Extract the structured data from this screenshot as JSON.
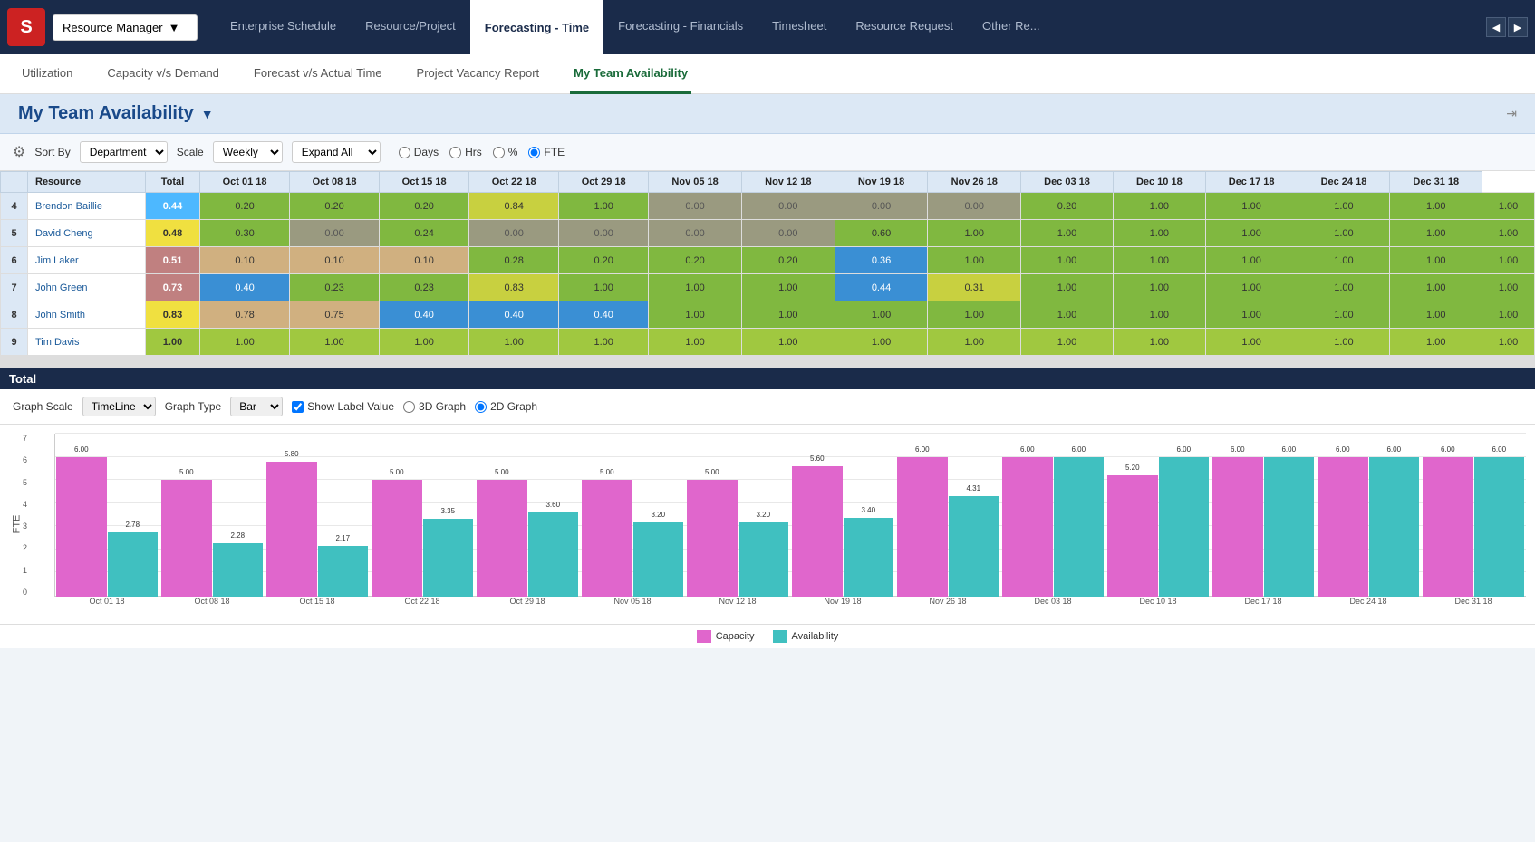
{
  "app": {
    "logo": "S",
    "resource_manager_label": "Resource Manager",
    "nav_arrow_left": "◀",
    "nav_arrow_right": "▶"
  },
  "top_nav": {
    "items": [
      {
        "label": "Enterprise Schedule",
        "active": false
      },
      {
        "label": "Resource/Project",
        "active": false
      },
      {
        "label": "Forecasting - Time",
        "active": true
      },
      {
        "label": "Forecasting - Financials",
        "active": false
      },
      {
        "label": "Timesheet",
        "active": false
      },
      {
        "label": "Resource Request",
        "active": false
      },
      {
        "label": "Other Re...",
        "active": false
      }
    ]
  },
  "sub_nav": {
    "items": [
      {
        "label": "Utilization",
        "active": false
      },
      {
        "label": "Capacity v/s Demand",
        "active": false
      },
      {
        "label": "Forecast v/s Actual Time",
        "active": false
      },
      {
        "label": "Project Vacancy Report",
        "active": false
      },
      {
        "label": "My Team Availability",
        "active": true
      }
    ]
  },
  "page_title": "My Team Availability",
  "toolbar": {
    "sort_by_label": "Sort By",
    "sort_by_value": "Department",
    "scale_label": "Scale",
    "scale_value": "Weekly",
    "expand_label": "Expand All",
    "radio_options": [
      "Days",
      "Hrs",
      "%",
      "FTE"
    ],
    "selected_radio": "FTE"
  },
  "table": {
    "headers": [
      "",
      "Resource",
      "Total",
      "Oct 01 18",
      "Oct 08 18",
      "Oct 15 18",
      "Oct 22 18",
      "Oct 29 18",
      "Nov 05 18",
      "Nov 12 18",
      "Nov 19 18",
      "Nov 26 18",
      "Dec 03 18",
      "Dec 10 18",
      "Dec 17 18",
      "Dec 24 18",
      "Dec 31 18"
    ],
    "rows": [
      {
        "num": "4",
        "name": "Brendon Baillie",
        "total": "0.44",
        "values": [
          "0.20",
          "0.20",
          "0.20",
          "0.84",
          "1.00",
          "0.00",
          "0.00",
          "0.00",
          "0.00",
          "0.20",
          "1.00",
          "1.00",
          "1.00",
          "1.00",
          "1.00"
        ],
        "total_color": "#4db8ff",
        "colors": [
          "#80b840",
          "#80b840",
          "#80b840",
          "#c8d040",
          "#80b840",
          "#808080",
          "#808080",
          "#808080",
          "#808080",
          "#80b840",
          "#80b840",
          "#80b840",
          "#80b840",
          "#80b840",
          "#80b840"
        ]
      },
      {
        "num": "5",
        "name": "David Cheng",
        "total": "0.48",
        "values": [
          "0.30",
          "0.00",
          "0.24",
          "0.00",
          "0.00",
          "0.00",
          "0.00",
          "0.60",
          "1.00",
          "1.00",
          "1.00",
          "1.00",
          "1.00",
          "1.00",
          "1.00"
        ],
        "total_color": "#f0e040",
        "colors": [
          "#80b840",
          "#808080",
          "#80b840",
          "#808080",
          "#808080",
          "#808080",
          "#808080",
          "#80b840",
          "#80b840",
          "#80b840",
          "#80b840",
          "#80b840",
          "#80b840",
          "#80b840",
          "#80b840"
        ]
      },
      {
        "num": "6",
        "name": "Jim Laker",
        "total": "0.51",
        "values": [
          "0.10",
          "0.10",
          "0.10",
          "0.28",
          "0.20",
          "0.20",
          "0.20",
          "0.36",
          "1.00",
          "1.00",
          "1.00",
          "1.00",
          "1.00",
          "1.00",
          "1.00"
        ],
        "total_color": "#c08080",
        "colors": [
          "#d0b080",
          "#d0b080",
          "#d0b080",
          "#80b840",
          "#80b840",
          "#80b840",
          "#80b840",
          "#4db8ff",
          "#80b840",
          "#80b840",
          "#80b840",
          "#80b840",
          "#80b840",
          "#80b840",
          "#80b840"
        ]
      },
      {
        "num": "7",
        "name": "John Green",
        "total": "0.73",
        "values": [
          "0.40",
          "0.23",
          "0.23",
          "0.83",
          "1.00",
          "1.00",
          "1.00",
          "0.44",
          "0.31",
          "1.00",
          "1.00",
          "1.00",
          "1.00",
          "1.00",
          "1.00"
        ],
        "total_color": "#c08080",
        "colors": [
          "#4db8ff",
          "#80b840",
          "#80b840",
          "#c8d040",
          "#80b840",
          "#80b840",
          "#80b840",
          "#4db8ff",
          "#c8d040",
          "#80b840",
          "#80b840",
          "#80b840",
          "#80b840",
          "#80b840",
          "#80b840"
        ]
      },
      {
        "num": "8",
        "name": "John Smith",
        "total": "0.83",
        "values": [
          "0.78",
          "0.75",
          "0.40",
          "0.40",
          "0.40",
          "1.00",
          "1.00",
          "1.00",
          "1.00",
          "1.00",
          "1.00",
          "1.00",
          "1.00",
          "1.00",
          "1.00"
        ],
        "total_color": "#f0e040",
        "colors": [
          "#d0b080",
          "#d0b080",
          "#4db8ff",
          "#4db8ff",
          "#4db8ff",
          "#80b840",
          "#80b840",
          "#80b840",
          "#80b840",
          "#80b840",
          "#80b840",
          "#80b840",
          "#80b840",
          "#80b840",
          "#80b840"
        ]
      },
      {
        "num": "9",
        "name": "Tim Davis",
        "total": "1.00",
        "values": [
          "1.00",
          "1.00",
          "1.00",
          "1.00",
          "1.00",
          "1.00",
          "1.00",
          "1.00",
          "1.00",
          "1.00",
          "1.00",
          "1.00",
          "1.00",
          "1.00",
          "1.00"
        ],
        "total_color": "#a0c840",
        "colors": [
          "#a0c840",
          "#a0c840",
          "#a0c840",
          "#a0c840",
          "#a0c840",
          "#a0c840",
          "#a0c840",
          "#a0c840",
          "#a0c840",
          "#a0c840",
          "#a0c840",
          "#a0c840",
          "#a0c840",
          "#a0c840",
          "#a0c840"
        ]
      }
    ]
  },
  "chart": {
    "section_title": "Total",
    "graph_scale_label": "Graph Scale",
    "graph_scale_value": "TimeLine",
    "graph_type_label": "Graph Type",
    "graph_type_value": "Bar",
    "show_label": "Show Label Value",
    "radio_3d": "3D Graph",
    "radio_2d": "2D Graph",
    "selected": "2D Graph",
    "y_label": "FTE",
    "y_max": 7,
    "x_labels": [
      "Oct 01 18",
      "Oct 08 18",
      "Oct 15 18",
      "Oct 22 18",
      "Oct 29 18",
      "Nov 05 18",
      "Nov 12 18",
      "Nov 19 18",
      "Nov 26 18",
      "Dec 03 18",
      "Dec 10 18",
      "Dec 17 18",
      "Dec 24 18",
      "Dec 31 18"
    ],
    "capacity": [
      6.0,
      5.0,
      5.8,
      5.0,
      5.0,
      5.0,
      5.0,
      5.6,
      6.0,
      6.0,
      5.2,
      6.0,
      6.0,
      6.0
    ],
    "availability": [
      2.78,
      2.28,
      2.17,
      3.35,
      3.6,
      3.2,
      3.2,
      3.4,
      4.31,
      6.0,
      6.0,
      6.0,
      6.0,
      6.0
    ],
    "legend": [
      {
        "label": "Capacity",
        "color": "#e066cc"
      },
      {
        "label": "Availability",
        "color": "#40c0c0"
      }
    ]
  }
}
